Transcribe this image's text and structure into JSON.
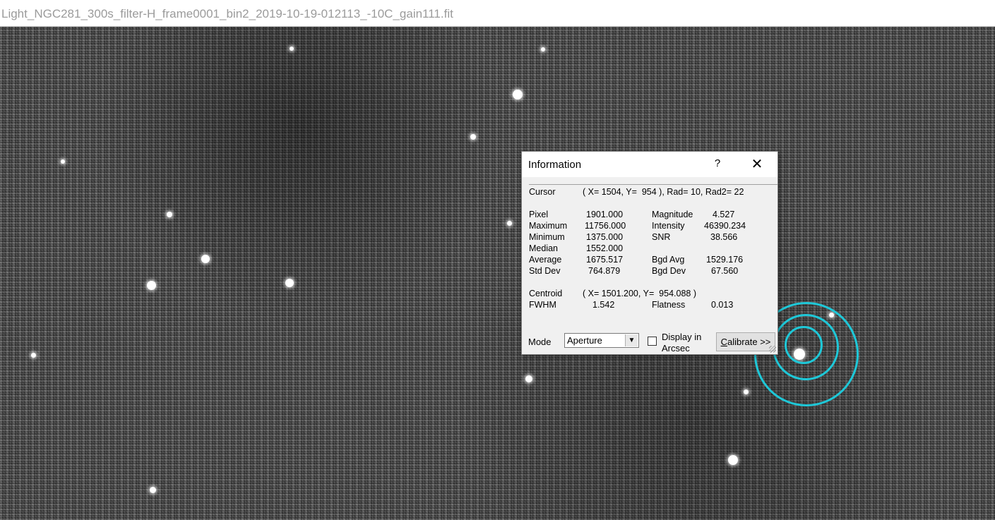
{
  "window": {
    "title": "Light_NGC281_300s_filter-H_frame0001_bin2_2019-10-19-012113_-10C_gain111.fit"
  },
  "dialog": {
    "title": "Information",
    "help_label": "?",
    "close_label": "✕",
    "cursor": {
      "label": "Cursor",
      "value": "( X= 1504, Y=  954 ), Rad= 10, Rad2= 22"
    },
    "stats_left": [
      {
        "label": "Pixel",
        "value": "1901.000"
      },
      {
        "label": "Maximum",
        "value": "11756.000"
      },
      {
        "label": "Minimum",
        "value": "1375.000"
      },
      {
        "label": "Median",
        "value": "1552.000"
      },
      {
        "label": "Average",
        "value": "1675.517"
      },
      {
        "label": "Std Dev",
        "value": "764.879"
      }
    ],
    "stats_right": [
      {
        "label": "Magnitude",
        "value": "4.527"
      },
      {
        "label": "Intensity",
        "value": "46390.234"
      },
      {
        "label": "SNR",
        "value": "38.566"
      },
      {
        "label": "Bgd Avg",
        "value": "1529.176"
      },
      {
        "label": "Bgd Dev",
        "value": "67.560"
      }
    ],
    "centroid": {
      "label": "Centroid",
      "value": "( X= 1501.200, Y=  954.088 )"
    },
    "fwhm": {
      "label": "FWHM",
      "value": "1.542"
    },
    "flatness": {
      "label": "Flatness",
      "value": "0.013"
    },
    "mode": {
      "label": "Mode",
      "selected": "Aperture"
    },
    "display_arcsec": {
      "label_line1": "Display in",
      "label_line2": "Arcsec",
      "checked": false
    },
    "calibrate_button": {
      "accel": "C",
      "rest": "alibrate >>"
    }
  },
  "colors": {
    "aperture_ring": "#1ec8d8"
  }
}
